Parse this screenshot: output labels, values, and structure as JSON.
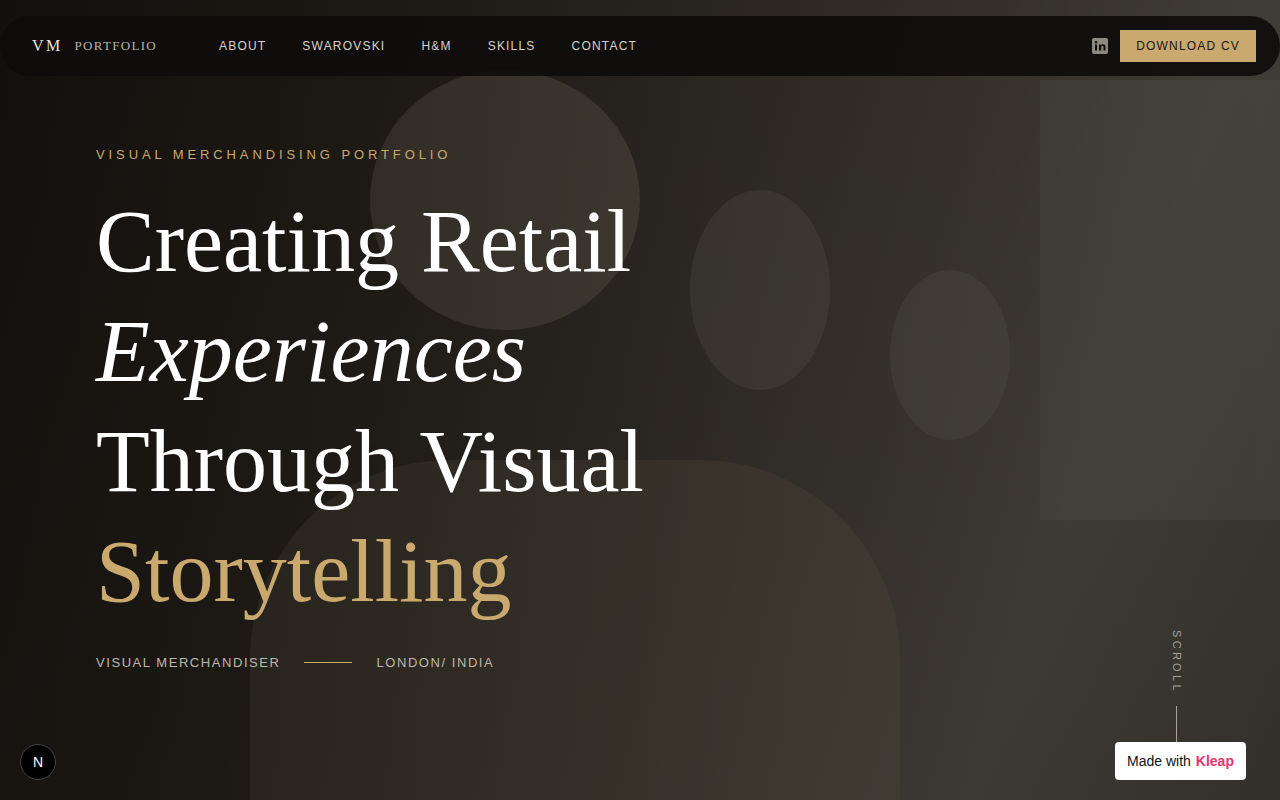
{
  "nav": {
    "logo_mark": "VM",
    "logo_text": "PORTFOLIO",
    "links": [
      "ABOUT",
      "SWAROVSKI",
      "H&M",
      "SKILLS",
      "CONTACT"
    ],
    "cta": "DOWNLOAD CV"
  },
  "hero": {
    "eyebrow": "VISUAL MERCHANDISING PORTFOLIO",
    "headline": [
      {
        "text": "Creating Retail",
        "kind": "plain"
      },
      {
        "text": "Experiences",
        "kind": "italic"
      },
      {
        "text": "Through Visual",
        "kind": "plain"
      },
      {
        "text": "Storytelling",
        "kind": "accent"
      }
    ],
    "role": "VISUAL MERCHANDISER",
    "location": "LONDON/ INDIA"
  },
  "scroll": "SCROLL",
  "dev_badge": "N",
  "made_with": {
    "prefix": "Made with",
    "brand": "Kleap"
  }
}
